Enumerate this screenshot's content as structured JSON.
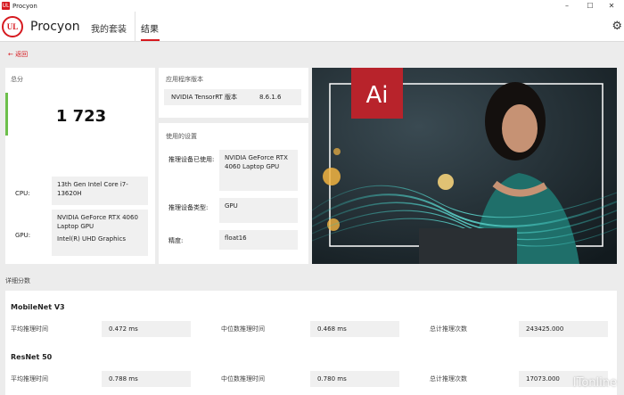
{
  "window": {
    "title": "Procyon",
    "app_icon_text": "UL",
    "min": "–",
    "max": "☐",
    "close": "✕"
  },
  "header": {
    "logo": "UL",
    "brand": "Procyon",
    "nav": {
      "suites": "我的套装",
      "results": "结果"
    },
    "gear_icon": "⚙"
  },
  "back": {
    "arrow": "←",
    "label": "返回"
  },
  "score_card": {
    "title": "总分",
    "score": "1 723",
    "cpu_label": "CPU:",
    "cpu_value": "13th Gen Intel Core i7-13620H",
    "gpu_label": "GPU:",
    "gpu_value_1": "NVIDIA GeForce RTX 4060 Laptop GPU",
    "gpu_value_2": "Intel(R) UHD Graphics"
  },
  "app_version_card": {
    "title": "应用程序版本",
    "name": "NVIDIA TensorRT 版本",
    "version": "8.6.1.6"
  },
  "settings_card": {
    "title": "使用的设置",
    "device_label": "推理设备已使用:",
    "device_value": "NVIDIA GeForce RTX 4060 Laptop GPU",
    "type_label": "推理设备类型:",
    "type_value": "GPU",
    "precision_label": "精度:",
    "precision_value": "float16"
  },
  "hero": {
    "badge": "Ai"
  },
  "details": {
    "title": "详细分数",
    "benchmarks": [
      {
        "name": "MobileNet V3",
        "avg_label": "平均推理时间",
        "avg": "0.472 ms",
        "med_label": "中位数推理时间",
        "med": "0.468 ms",
        "total_label": "总计推理次数",
        "total": "243425.000"
      },
      {
        "name": "ResNet 50",
        "avg_label": "平均推理时间",
        "avg": "0.788 ms",
        "med_label": "中位数推理时间",
        "med": "0.780 ms",
        "total_label": "总计推理次数",
        "total": "17073.000"
      }
    ]
  },
  "watermark": "ITonline",
  "colors": {
    "accent": "#d6191f",
    "score_bar": "#6dbf4b",
    "hero_teal": "#1f8a86"
  }
}
